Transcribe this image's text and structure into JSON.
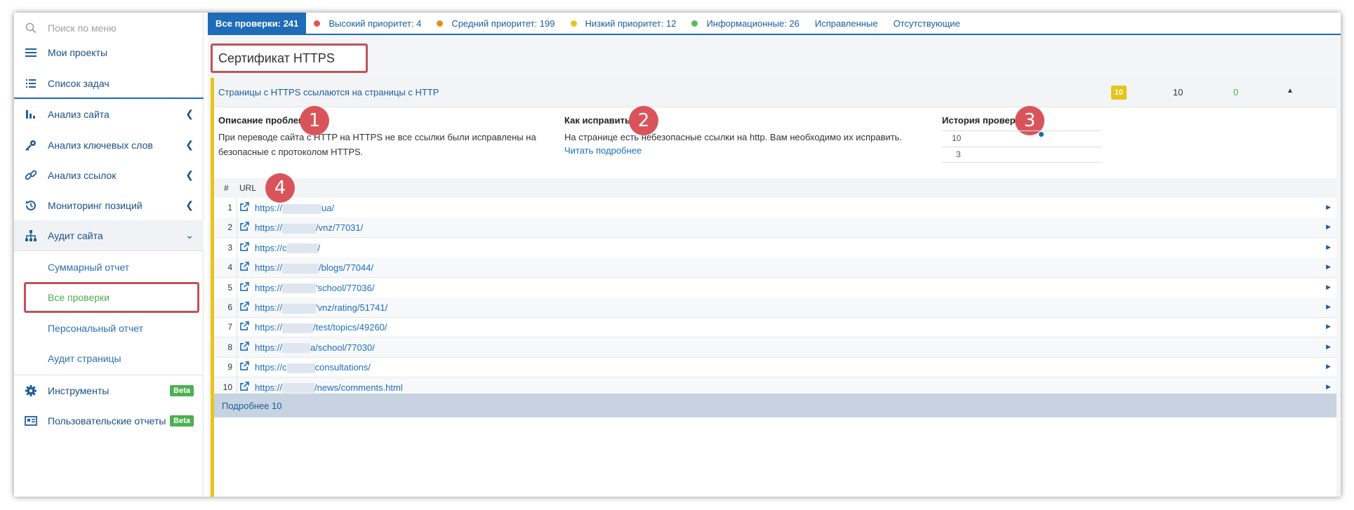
{
  "sidebar": {
    "search_placeholder": "Поиск по меню",
    "items": [
      {
        "label": "Мои проекты"
      },
      {
        "label": "Список задач"
      },
      {
        "label": "Анализ сайта"
      },
      {
        "label": "Анализ ключевых слов"
      },
      {
        "label": "Анализ ссылок"
      },
      {
        "label": "Мониторинг позиций"
      },
      {
        "label": "Аудит сайта"
      }
    ],
    "sub_items": [
      {
        "label": "Суммарный отчет"
      },
      {
        "label": "Все проверки"
      },
      {
        "label": "Персональный отчет"
      },
      {
        "label": "Аудит страницы"
      }
    ],
    "tools": {
      "label": "Инструменты",
      "badge": "Beta"
    },
    "custom_reports": {
      "label": "Пользовательские отчеты",
      "badge": "Beta"
    }
  },
  "tabs": {
    "all": "Все проверки: 241",
    "high": "Высокий приоритет: 4",
    "medium": "Средний приоритет: 199",
    "low": "Низкий приоритет: 12",
    "info": "Информационные: 26",
    "fixed": "Исправленные",
    "missing": "Отсутствующие"
  },
  "colors": {
    "high": "#e0555a",
    "medium": "#e98a2a",
    "low": "#e6c419",
    "info": "#5cb85c",
    "accent": "#1e6bb8",
    "marker": "#d9545a"
  },
  "page_title": "Сертификат HTTPS",
  "check": {
    "title": "Страницы с HTTPS ссылаются на страницы с HTTP",
    "new_count": "10",
    "total_count": "10",
    "fixed_count": "0"
  },
  "description": {
    "heading": "Описание проблемы",
    "text": "При переводе сайта с HTTP на HTTPS не все ссылки были исправлены на безопасные с протоколом HTTPS."
  },
  "howto": {
    "heading": "Как исправить?",
    "text": "На странице есть небезопасные ссылки на http. Вам необходимо их исправить.",
    "link": "Читать подробнее"
  },
  "history": {
    "heading": "История проверки",
    "label_top": "10",
    "label_bottom": "3"
  },
  "markers": [
    "1",
    "2",
    "3",
    "4"
  ],
  "table": {
    "col_num": "#",
    "col_url": "URL",
    "rows": [
      {
        "num": "1",
        "prefix": "https://",
        "suffix": "ua/"
      },
      {
        "num": "2",
        "prefix": "https://",
        "suffix": "/vnz/77031/"
      },
      {
        "num": "3",
        "prefix": "https://c",
        "suffix": "/"
      },
      {
        "num": "4",
        "prefix": "https://",
        "suffix": "/blogs/77044/"
      },
      {
        "num": "5",
        "prefix": "https://",
        "suffix": "'school/77036/"
      },
      {
        "num": "6",
        "prefix": "https://",
        "suffix": "'vnz/rating/51741/"
      },
      {
        "num": "7",
        "prefix": "https://",
        "suffix": "/test/topics/49260/"
      },
      {
        "num": "8",
        "prefix": "https://",
        "suffix": "a/school/77030/"
      },
      {
        "num": "9",
        "prefix": "https://c",
        "suffix": "consultations/"
      },
      {
        "num": "10",
        "prefix": "https://",
        "suffix": "/news/comments.html"
      }
    ]
  },
  "more_link": "Подробнее 10"
}
